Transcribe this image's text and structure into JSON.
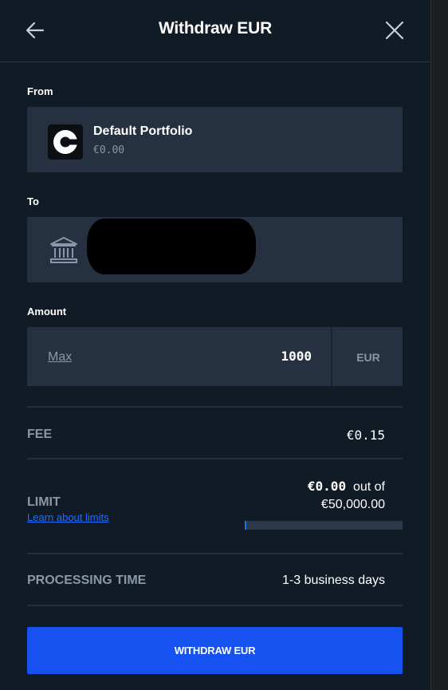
{
  "header": {
    "title": "Withdraw EUR",
    "back_icon": "arrow-left-icon",
    "close_icon": "close-icon"
  },
  "from": {
    "label": "From",
    "portfolio_name": "Default Portfolio",
    "balance": "€0.00",
    "logo_icon": "coinbase-logo"
  },
  "to": {
    "label": "To",
    "bank_icon": "bank-icon"
  },
  "amount": {
    "label": "Amount",
    "max_label": "Max",
    "value": "1000",
    "currency": "EUR"
  },
  "fee": {
    "label": "FEE",
    "value": "€0.15"
  },
  "limit": {
    "label": "LIMIT",
    "link": "Learn about limits",
    "used": "€0.00",
    "out_of": "out of",
    "total": "€50,000.00",
    "used_fraction": 0
  },
  "processing": {
    "label": "PROCESSING TIME",
    "value": "1-3 business days"
  },
  "action": {
    "button_label": "WITHDRAW EUR"
  },
  "colors": {
    "background": "#111b26",
    "card": "#253140",
    "accent": "#1652f0",
    "link": "#1b6fff",
    "muted": "#8a97a8"
  }
}
